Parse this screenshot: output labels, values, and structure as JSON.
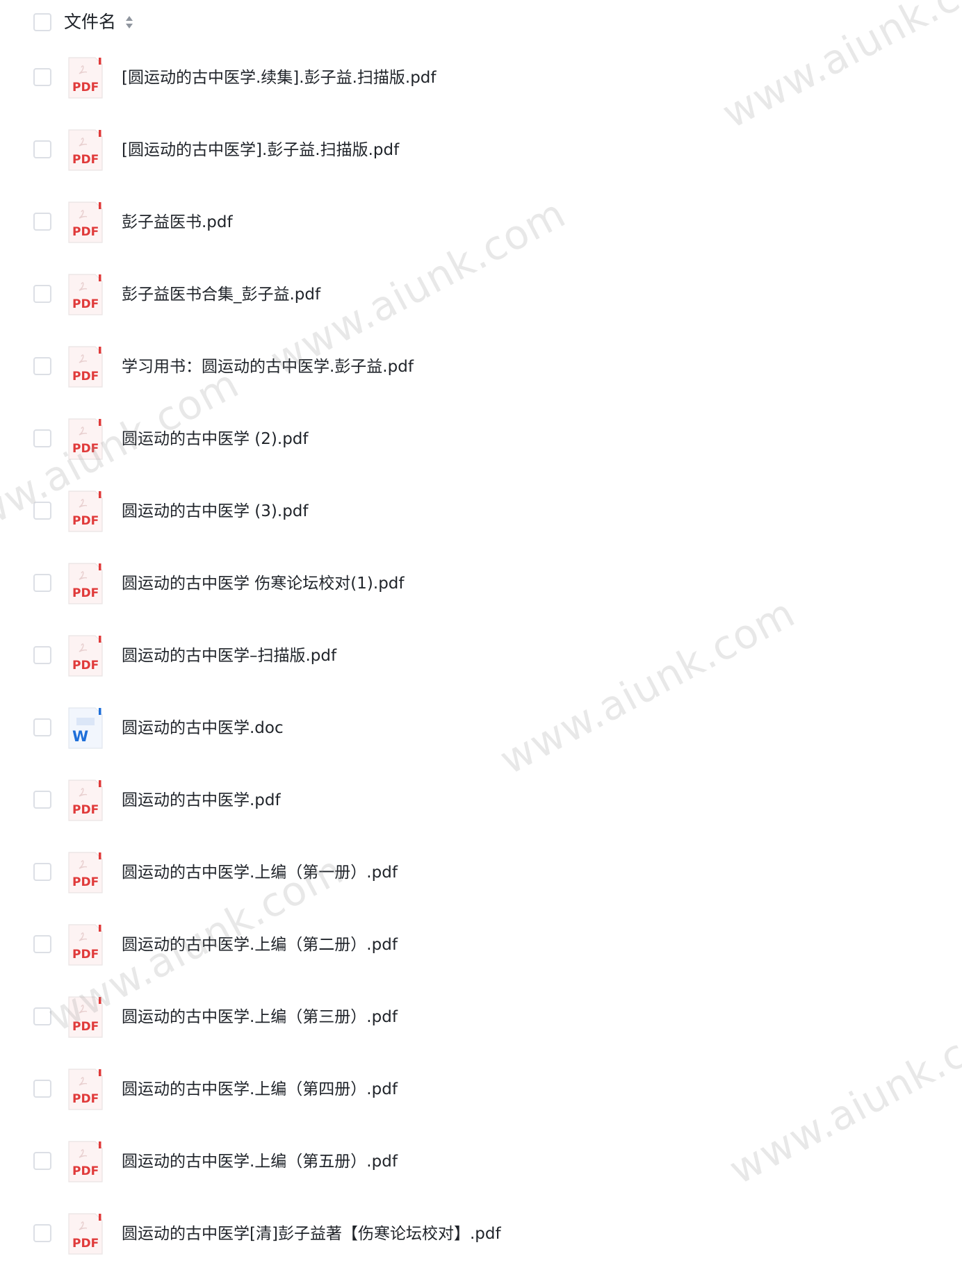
{
  "header": {
    "column_label": "文件名"
  },
  "files": [
    {
      "name": "[圆运动的古中医学.续集].彭子益.扫描版.pdf",
      "type": "pdf"
    },
    {
      "name": "[圆运动的古中医学].彭子益.扫描版.pdf",
      "type": "pdf"
    },
    {
      "name": "彭子益医书.pdf",
      "type": "pdf"
    },
    {
      "name": "彭子益医书合集_彭子益.pdf",
      "type": "pdf"
    },
    {
      "name": "学习用书：圆运动的古中医学.彭子益.pdf",
      "type": "pdf"
    },
    {
      "name": "圆运动的古中医学 (2).pdf",
      "type": "pdf"
    },
    {
      "name": "圆运动的古中医学 (3).pdf",
      "type": "pdf"
    },
    {
      "name": "圆运动的古中医学 伤寒论坛校对(1).pdf",
      "type": "pdf"
    },
    {
      "name": "圆运动的古中医学–扫描版.pdf",
      "type": "pdf"
    },
    {
      "name": "圆运动的古中医学.doc",
      "type": "doc"
    },
    {
      "name": "圆运动的古中医学.pdf",
      "type": "pdf"
    },
    {
      "name": "圆运动的古中医学.上编（第一册）.pdf",
      "type": "pdf"
    },
    {
      "name": "圆运动的古中医学.上编（第二册）.pdf",
      "type": "pdf"
    },
    {
      "name": "圆运动的古中医学.上编（第三册）.pdf",
      "type": "pdf"
    },
    {
      "name": "圆运动的古中医学.上编（第四册）.pdf",
      "type": "pdf"
    },
    {
      "name": "圆运动的古中医学.上编（第五册）.pdf",
      "type": "pdf"
    },
    {
      "name": "圆运动的古中医学[清]彭子益著【伤寒论坛校对】.pdf",
      "type": "pdf"
    }
  ],
  "icons": {
    "pdf_label": "PDF",
    "doc_label": "W",
    "pdf_color": "#e03a3a",
    "doc_color": "#1f6fd9"
  },
  "watermark": {
    "text": "www.aiunk.com"
  }
}
